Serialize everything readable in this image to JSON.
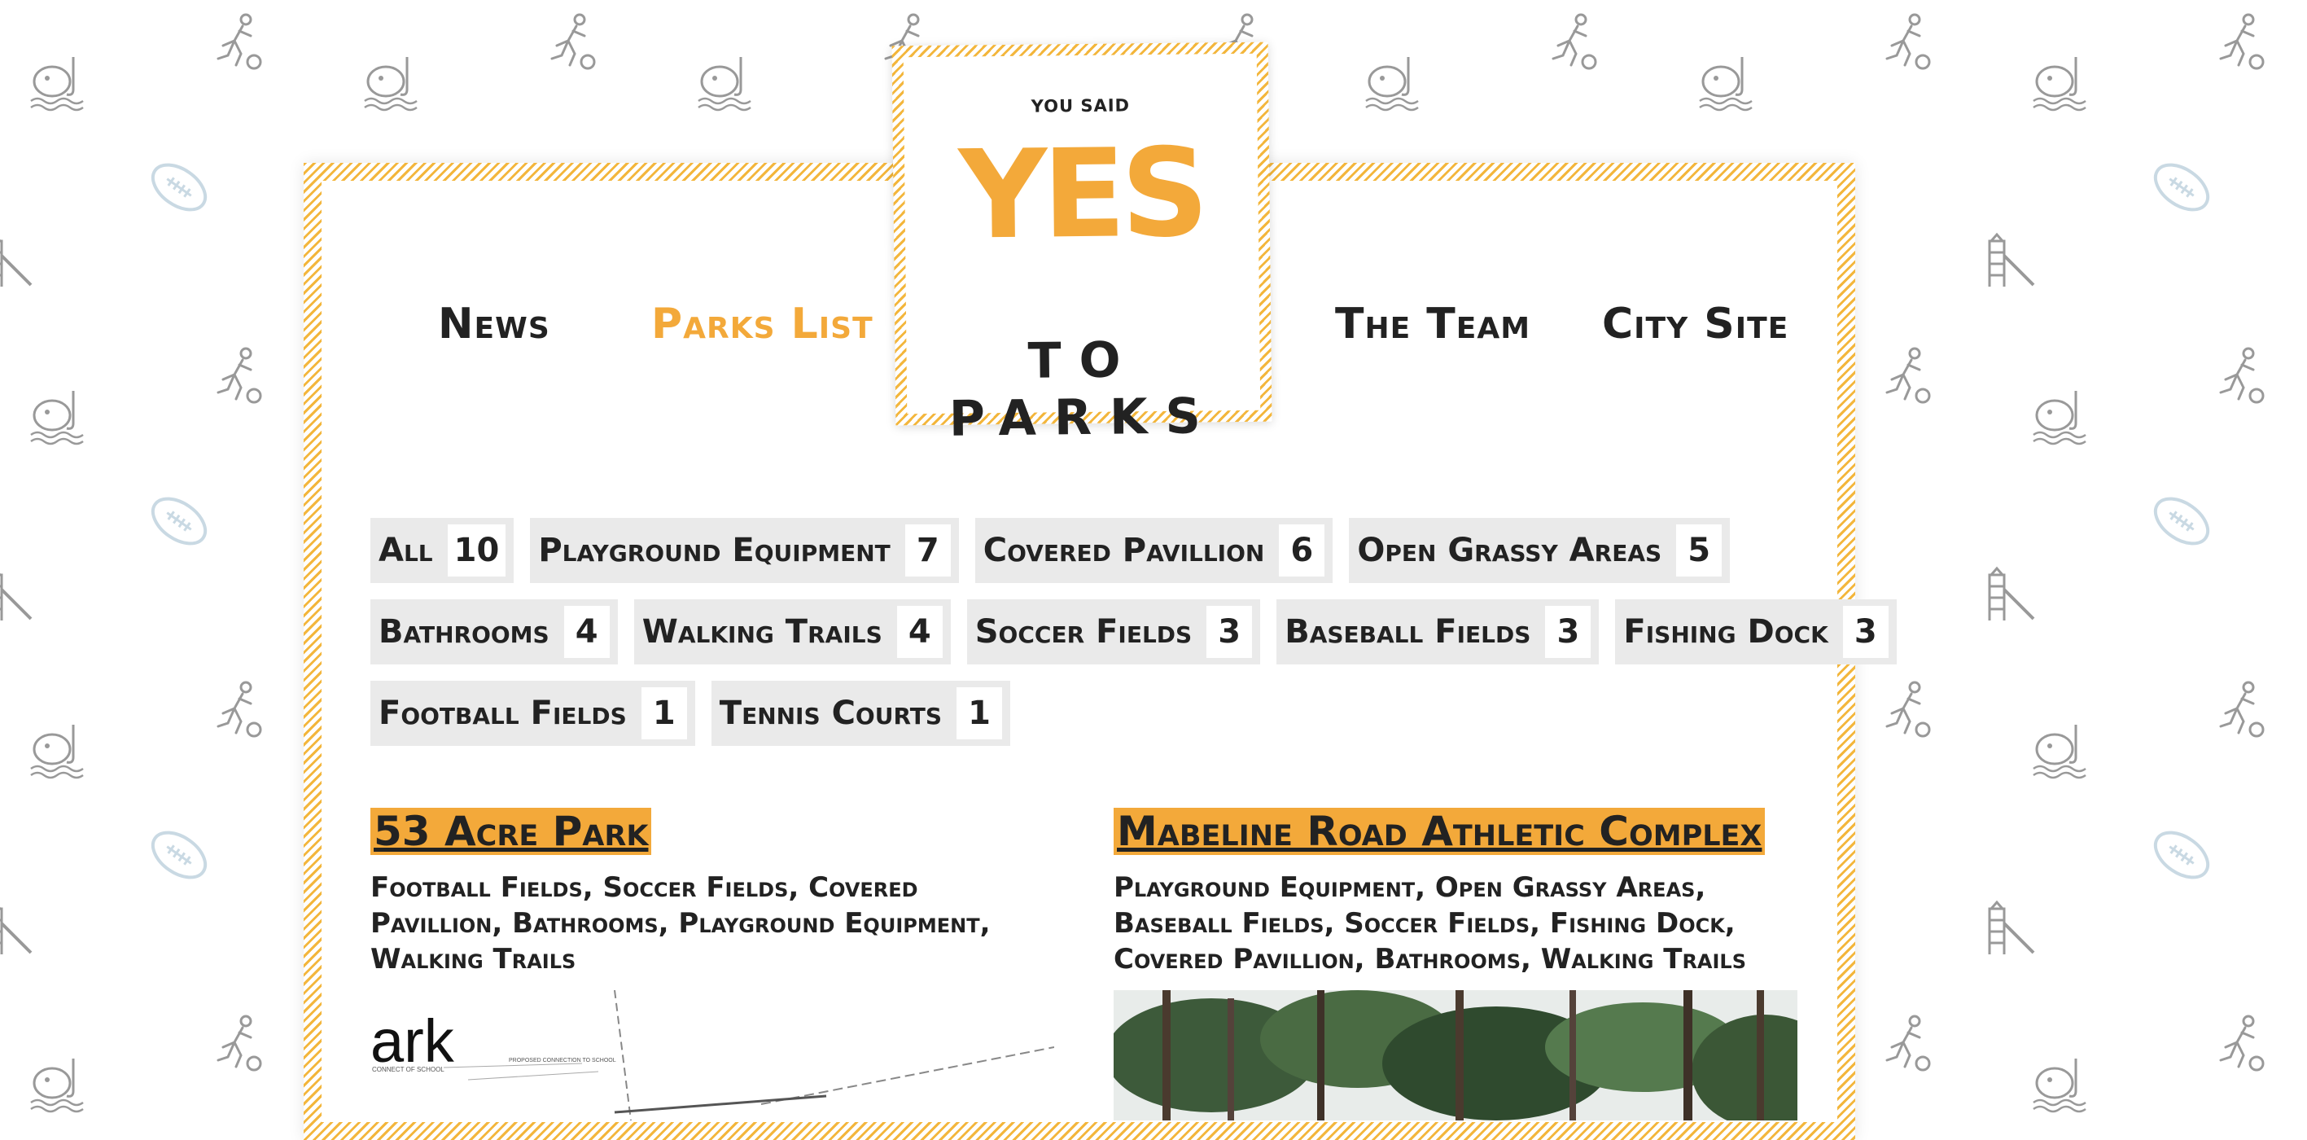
{
  "site": {
    "logo": {
      "top_text": "YOU SAID",
      "big_text": "YES",
      "bottom_text": "TO PARKS"
    },
    "nav": [
      {
        "label": "News",
        "active": false
      },
      {
        "label": "Parks List",
        "active": true
      },
      {
        "label": "The Team",
        "active": false
      },
      {
        "label": "City Site",
        "active": false
      }
    ]
  },
  "filters": [
    {
      "label": "All",
      "count": "10"
    },
    {
      "label": "Playground Equipment",
      "count": "7"
    },
    {
      "label": "Covered Pavillion",
      "count": "6"
    },
    {
      "label": "Open Grassy Areas",
      "count": "5"
    },
    {
      "label": "Bathrooms",
      "count": "4"
    },
    {
      "label": "Walking Trails",
      "count": "4"
    },
    {
      "label": "Soccer Fields",
      "count": "3"
    },
    {
      "label": "Baseball Fields",
      "count": "3"
    },
    {
      "label": "Fishing Dock",
      "count": "3"
    },
    {
      "label": "Football Fields",
      "count": "1"
    },
    {
      "label": "Tennis Courts",
      "count": "1"
    }
  ],
  "parks": [
    {
      "name": "53 Acre Park",
      "features": "Football Fields, Soccer Fields, Covered Pavillion, Bathrooms, Playground Equipment, Walking Trails",
      "image_text": "ark",
      "image_labels": [
        "PROPOSED CONNECTION TO SCHOOL",
        "CONNECT OF SCHOOL"
      ]
    },
    {
      "name": "Mabeline Road Athletic Complex",
      "features": "Playground Equipment, Open Grassy Areas, Baseball Fields, Soccer Fields, Fishing Dock, Covered Pavillion, Bathrooms, Walking Trails"
    }
  ],
  "colors": {
    "accent": "#f3a93a",
    "stripe": "#f3b63c",
    "text": "#222222",
    "tag_bg": "#eaeaea",
    "football_icon": "#c9d9e3",
    "line_icon": "#999999"
  },
  "background_icons": [
    "soccer-player-icon",
    "fishing-icon",
    "football-icon",
    "slide-icon"
  ]
}
